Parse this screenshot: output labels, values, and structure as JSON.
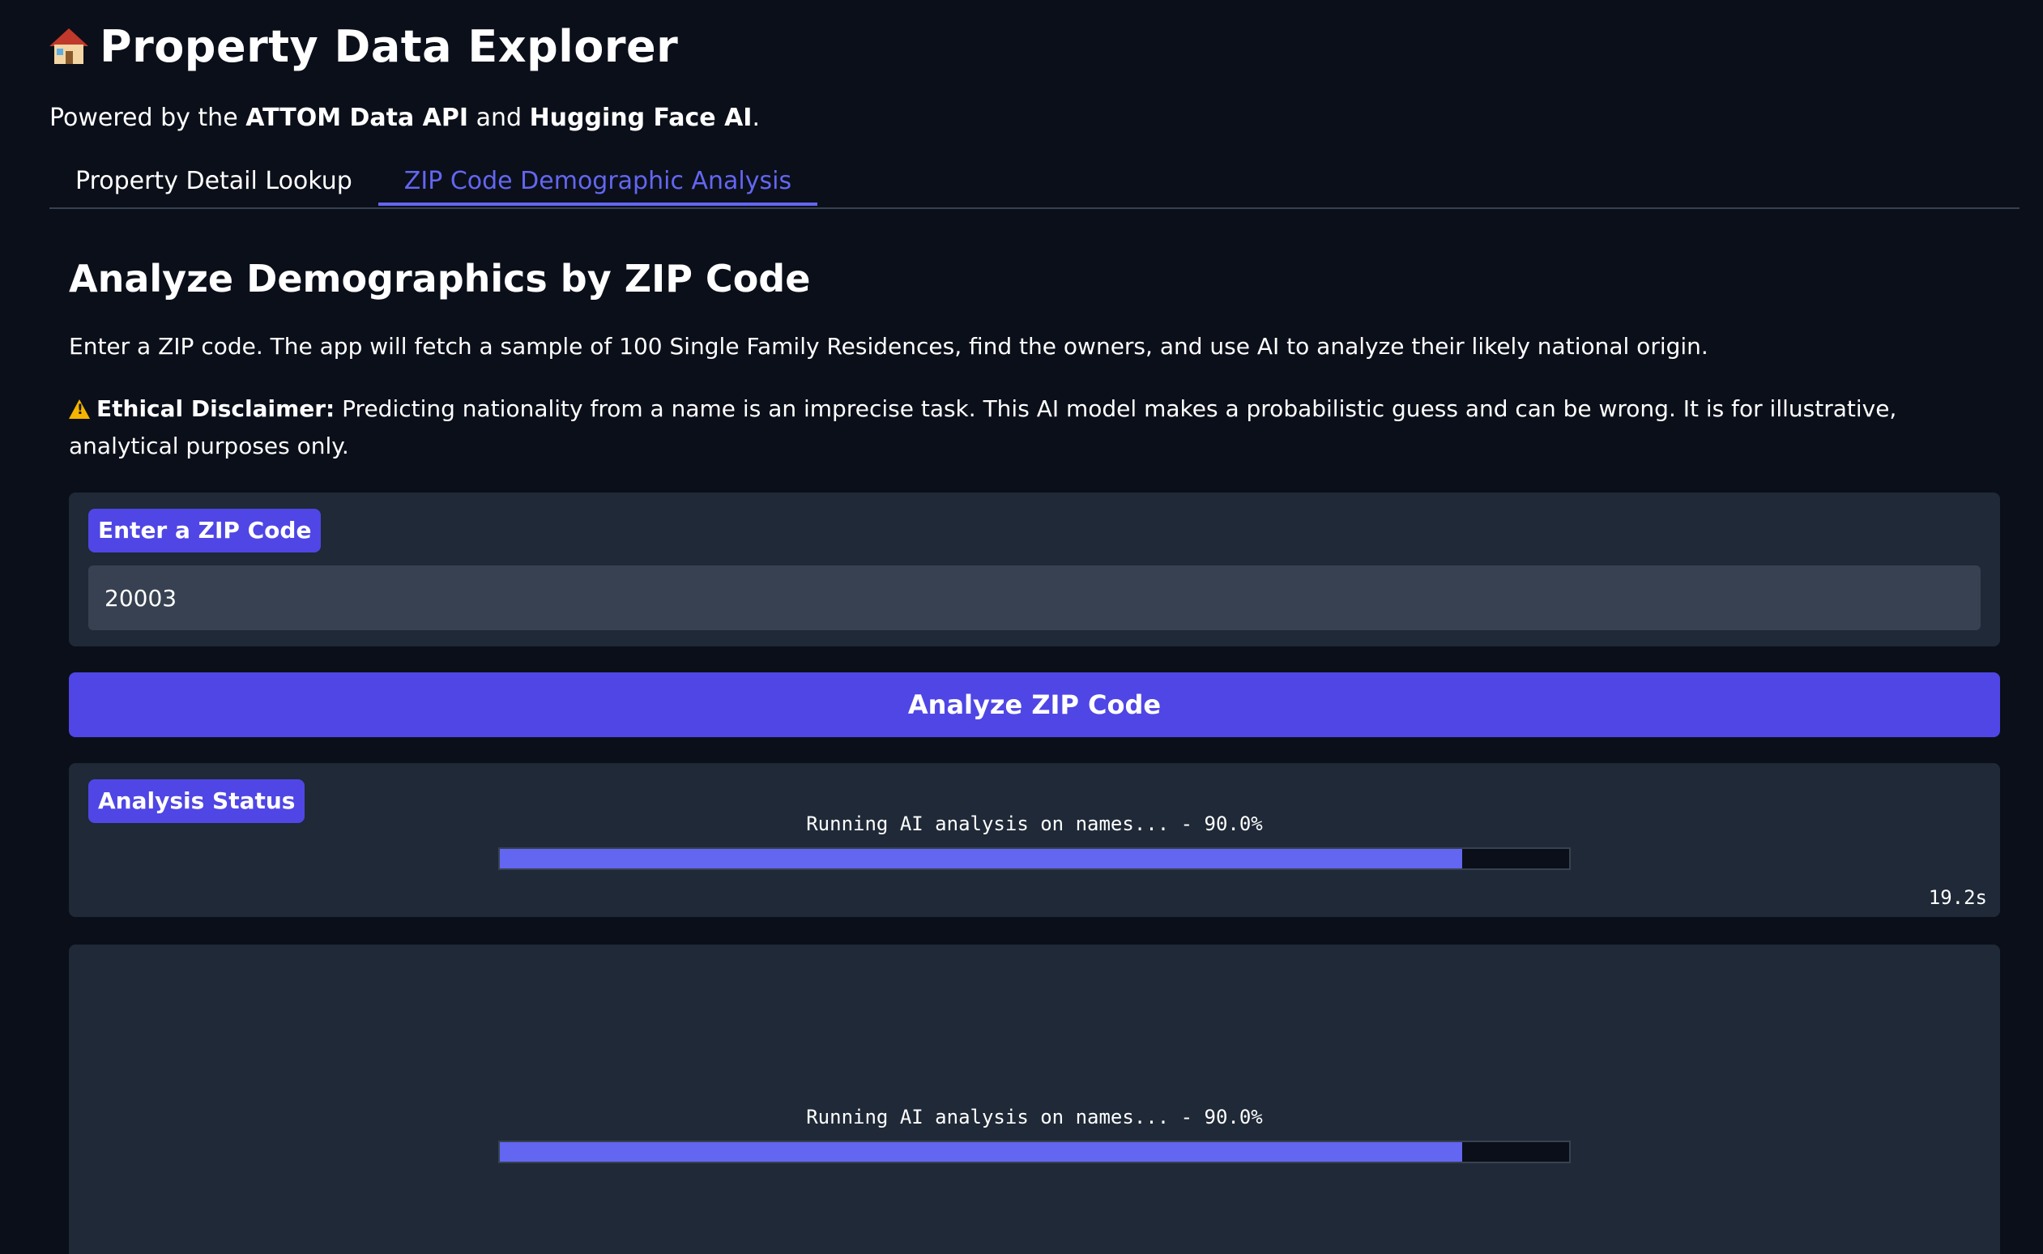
{
  "app": {
    "title": "Property Data Explorer",
    "title_icon": "house-icon"
  },
  "subtitle": {
    "prefix": "Powered by the ",
    "api_name": "ATTOM Data API",
    "middle": " and ",
    "ai_name": "Hugging Face AI",
    "suffix": "."
  },
  "tabs": [
    {
      "label": "Property Detail Lookup",
      "active": false
    },
    {
      "label": "ZIP Code Demographic Analysis",
      "active": true
    }
  ],
  "section": {
    "heading": "Analyze Demographics by ZIP Code",
    "description": "Enter a ZIP code. The app will fetch a sample of 100 Single Family Residences, find the owners, and use AI to analyze their likely national origin.",
    "disclaimer_label": "Ethical Disclaimer:",
    "disclaimer_text": " Predicting nationality from a name is an imprecise task. This AI model makes a probabilistic guess and can be wrong. It is for illustrative, analytical purposes only."
  },
  "zip_input": {
    "label": "Enter a ZIP Code",
    "value": "20003"
  },
  "analyze_button": {
    "label": "Analyze ZIP Code"
  },
  "status": {
    "label": "Analysis Status",
    "progress_text": "Running AI analysis on names... - 90.0%",
    "progress_fraction": 0.9,
    "elapsed": "19.2s"
  },
  "output": {
    "progress_text": "Running AI analysis on names... - 90.0%",
    "progress_fraction": 0.9
  },
  "colors": {
    "accent": "#4f46e5",
    "progress_fill": "#6366f1",
    "background": "#0b0f19",
    "panel": "#1f2937"
  }
}
